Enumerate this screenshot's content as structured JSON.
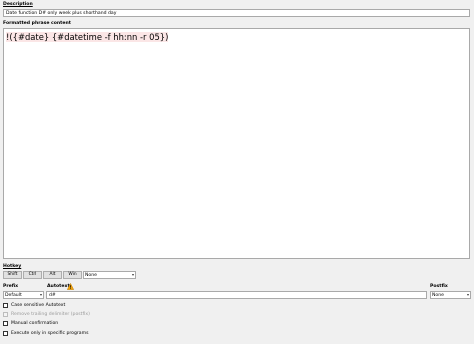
{
  "description": {
    "label": "Description",
    "value": "Date function D# only week plus shorthand day"
  },
  "content": {
    "label": "Formatted phrase content",
    "text": "!({#date} {#datetime -f hh:nn -r 05})"
  },
  "hotkey": {
    "label": "Hotkey",
    "buttons": [
      "Shift",
      "Ctrl",
      "Alt",
      "Win"
    ],
    "key_value": "None"
  },
  "prefix": {
    "label": "Prefix",
    "value": "Default"
  },
  "autotext": {
    "label": "Autotext",
    "value": "d#",
    "warning_icon": "warning-triangle-icon"
  },
  "postfix": {
    "label": "Postfix",
    "value": "None"
  },
  "options": [
    {
      "label": "Case sensitive Autotext",
      "checked": false,
      "enabled": true
    },
    {
      "label": "Remove trailing delimiter (postfix)",
      "checked": false,
      "enabled": false
    },
    {
      "label": "Manual confirmation",
      "checked": false,
      "enabled": true
    },
    {
      "label": "Execute only in specific programs",
      "checked": false,
      "enabled": true
    }
  ],
  "colors": {
    "background": "#f0f0f0",
    "warning": "#f0a30a",
    "text_highlight": "#fbe6e6"
  }
}
